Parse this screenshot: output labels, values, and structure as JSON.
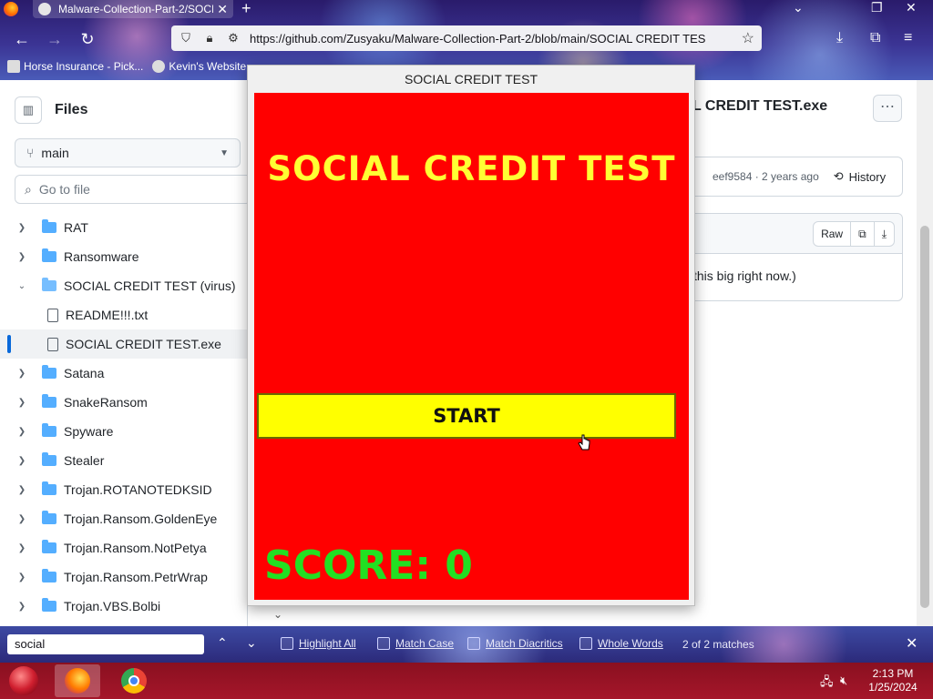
{
  "browser": {
    "tab_title": "Malware-Collection-Part-2/SOCI",
    "url": "https://github.com/Zusyaku/Malware-Collection-Part-2/blob/main/SOCIAL CREDIT TES",
    "bookmarks": [
      "Horse Insurance - Pick...",
      "Kevin's Website"
    ]
  },
  "sidebar": {
    "title": "Files",
    "branch": "main",
    "goto_placeholder": "Go to file",
    "tree": [
      {
        "label": "RAT",
        "type": "folder",
        "expanded": false
      },
      {
        "label": "Ransomware",
        "type": "folder",
        "expanded": false
      },
      {
        "label": "SOCIAL CREDIT TEST (virus)",
        "type": "folder",
        "expanded": true
      },
      {
        "label": "README!!!.txt",
        "type": "file"
      },
      {
        "label": "SOCIAL CREDIT TEST.exe",
        "type": "file",
        "active": true
      },
      {
        "label": "Satana",
        "type": "folder",
        "expanded": false
      },
      {
        "label": "SnakeRansom",
        "type": "folder",
        "expanded": false
      },
      {
        "label": "Spyware",
        "type": "folder",
        "expanded": false
      },
      {
        "label": "Stealer",
        "type": "folder",
        "expanded": false
      },
      {
        "label": "Trojan.ROTANOTEDKSID",
        "type": "folder",
        "expanded": false
      },
      {
        "label": "Trojan.Ransom.GoldenEye",
        "type": "folder",
        "expanded": false
      },
      {
        "label": "Trojan.Ransom.NotPetya",
        "type": "folder",
        "expanded": false
      },
      {
        "label": "Trojan.Ransom.PetrWrap",
        "type": "folder",
        "expanded": false
      },
      {
        "label": "Trojan.VBS.Bolbi",
        "type": "folder",
        "expanded": false
      }
    ]
  },
  "main": {
    "file_title": "OCIAL CREDIT TEST.exe",
    "commit_info": "eef9584 · 2 years ago",
    "history_label": "History",
    "raw_label": "Raw",
    "file_message": "this big right now.)"
  },
  "game": {
    "window_title": "SOCIAL CREDIT TEST",
    "title": "SOCIAL CREDIT TEST",
    "start_label": "START",
    "score_label": "SCORE:",
    "score_value": "0",
    "canvas_color": "#ff0000"
  },
  "findbar": {
    "query": "social",
    "options": [
      "Highlight All",
      "Match Case",
      "Match Diacritics",
      "Whole Words"
    ],
    "match_count": "2 of 2 matches"
  },
  "taskbar": {
    "time": "2:13 PM",
    "date": "1/25/2024"
  }
}
